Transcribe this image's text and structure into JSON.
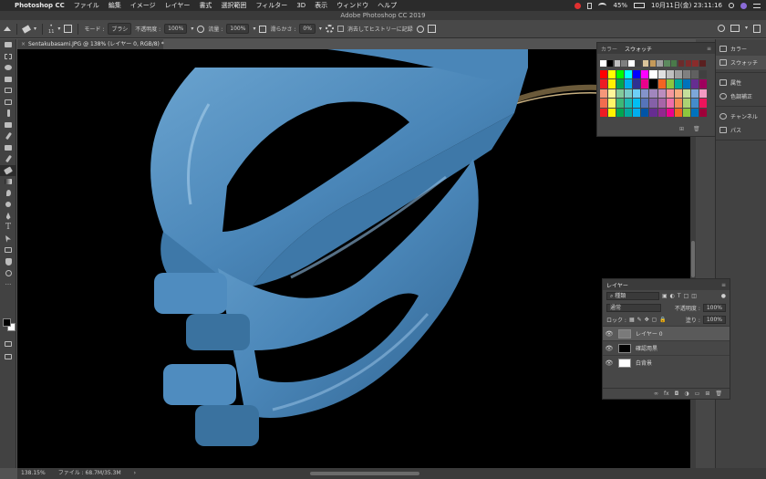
{
  "menubar": {
    "app": "Photoshop CC",
    "items": [
      "ファイル",
      "編集",
      "イメージ",
      "レイヤー",
      "書式",
      "選択範囲",
      "フィルター",
      "3D",
      "表示",
      "ウィンドウ",
      "ヘルプ"
    ],
    "battery": "45%",
    "datetime": "10月11日(金)  23:11:16"
  },
  "window": {
    "title": "Adobe Photoshop CC 2019"
  },
  "options": {
    "size": "11",
    "mode_label": "モード :",
    "mode_value": "ブラシ",
    "opacity_label": "不透明度 :",
    "opacity_value": "100%",
    "flow_label": "流量 :",
    "flow_value": "100%",
    "smoothing_label": "滑らかさ :",
    "smoothing_value": "0%",
    "history_label": "消去してヒストリーに記録"
  },
  "document": {
    "tab": "Sentakubasami.JPG @ 138% (レイヤー 0, RGB/8) *",
    "zoom": "138.15%",
    "file_info": "ファイル : 68.7M/35.3M"
  },
  "swatches_panel": {
    "tab_color": "カラー",
    "tab_swatches": "スウォッチ",
    "first_row": [
      "#ffffff",
      "#000000",
      "#bfbfbf",
      "#7f7f7f",
      "#ffffff",
      "#3f3f3f",
      "#d9c49a",
      "#c59a5a",
      "#a0a0a0",
      "#5c8a5e",
      "#4a7a4a",
      "#6b2b2b",
      "#7d2a2a",
      "#8a2b2b",
      "#5a2020"
    ],
    "rows": [
      [
        "#ff0000",
        "#ffff00",
        "#00ff00",
        "#00ffff",
        "#0000ff",
        "#ff00ff",
        "#ffffff",
        "#e0e0e0",
        "#c0c0c0",
        "#a0a0a0",
        "#808080",
        "#606060",
        "#404040"
      ],
      [
        "#ed1c24",
        "#fff200",
        "#00a651",
        "#00aeef",
        "#2e3192",
        "#ec008c",
        "#000000",
        "#f26522",
        "#8dc63f",
        "#00a99d",
        "#0072bc",
        "#662d91",
        "#9e005d"
      ],
      [
        "#f7977a",
        "#fff79a",
        "#82ca9c",
        "#7accc8",
        "#6dcff6",
        "#8493ca",
        "#a186be",
        "#bc8dbf",
        "#f6989d",
        "#f9ad81",
        "#c4df9b",
        "#7da7d9",
        "#f49ac2"
      ],
      [
        "#f26c4f",
        "#fff568",
        "#3cb878",
        "#1cbbb4",
        "#00bff3",
        "#5674b9",
        "#8560a8",
        "#a864a8",
        "#f06eaa",
        "#f68e56",
        "#acd373",
        "#448ccb",
        "#ed145b"
      ],
      [
        "#ed1c24",
        "#fff200",
        "#00a651",
        "#00a99d",
        "#00aeef",
        "#0054a6",
        "#662d91",
        "#92278f",
        "#ec008c",
        "#f26522",
        "#8dc63f",
        "#0072bc",
        "#9e0039"
      ]
    ]
  },
  "dock": {
    "items": [
      "カラー",
      "スウォッチ",
      "属性",
      "色調補正",
      "チャンネル",
      "パス"
    ]
  },
  "layers_panel": {
    "title": "レイヤー",
    "filter": "種類",
    "blend": "通常",
    "opacity_label": "不透明度 :",
    "opacity_value": "100%",
    "lock_label": "ロック :",
    "fill_label": "塗り :",
    "fill_value": "100%",
    "layers": [
      {
        "name": "レイヤー 0",
        "thumb": "#7a7a7a",
        "active": true
      },
      {
        "name": "確認用黒",
        "thumb": "#000000",
        "active": false
      },
      {
        "name": "白背景",
        "thumb": "#ffffff",
        "active": false
      }
    ]
  },
  "colors": {
    "clip_blue": "#4a86b8",
    "canvas": "#000000"
  }
}
